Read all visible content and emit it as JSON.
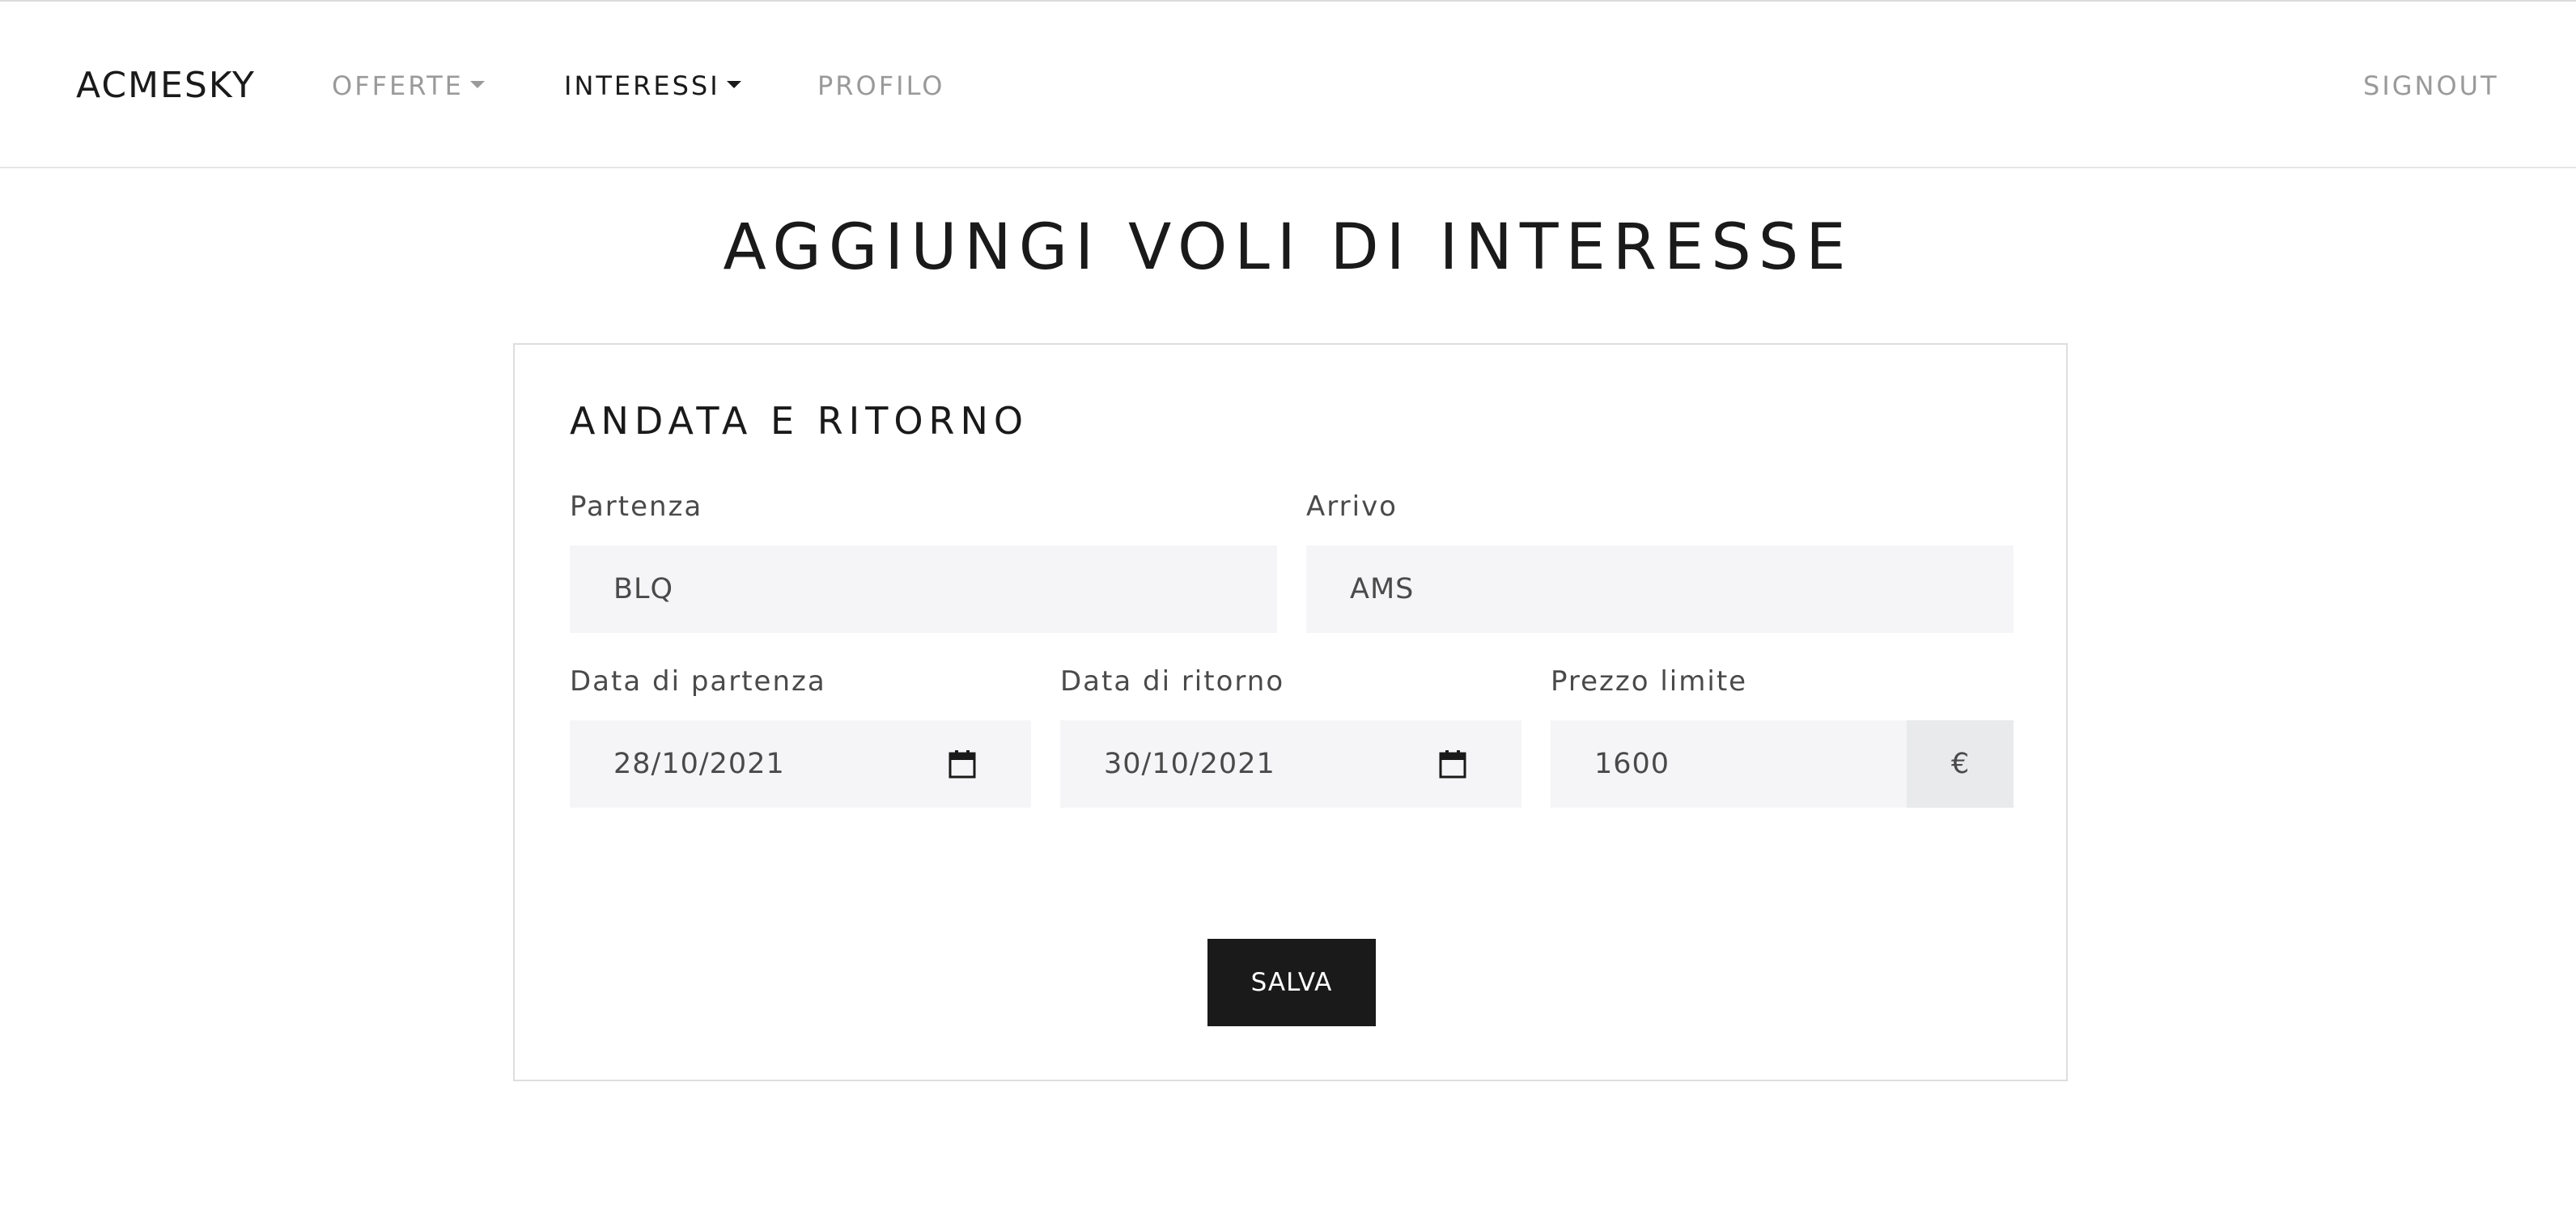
{
  "nav": {
    "brand": "ACMESKY",
    "items": [
      {
        "label": "OFFERTE",
        "has_dropdown": true,
        "active": false
      },
      {
        "label": "INTERESSI",
        "has_dropdown": true,
        "active": true
      },
      {
        "label": "PROFILO",
        "has_dropdown": false,
        "active": false
      }
    ],
    "signout": "SIGNOUT"
  },
  "page": {
    "title": "AGGIUNGI VOLI DI INTERESSE"
  },
  "form": {
    "section_title": "ANDATA E RITORNO",
    "departure": {
      "label": "Partenza",
      "value": "BLQ"
    },
    "arrival": {
      "label": "Arrivo",
      "value": "AMS"
    },
    "departure_date": {
      "label": "Data di partenza",
      "value": "28/10/2021",
      "icon": "calendar-icon"
    },
    "return_date": {
      "label": "Data di ritorno",
      "value": "30/10/2021",
      "icon": "calendar-icon"
    },
    "price_limit": {
      "label": "Prezzo limite",
      "value": "1600",
      "currency": "€"
    },
    "save_label": "SALVA"
  },
  "colors": {
    "text_dark": "#1a1a1a",
    "nav_inactive": "#9a9a9a",
    "input_bg": "#f5f5f7",
    "addon_bg": "#e9eaec",
    "button_bg": "#1a1a1a",
    "button_text": "#ffffff",
    "border": "#dedede"
  }
}
